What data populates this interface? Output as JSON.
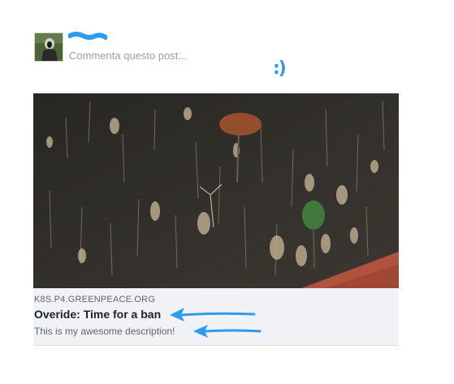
{
  "post": {
    "comment_placeholder": "Commenta questo post...",
    "emoji_annotation": ":)"
  },
  "link_card": {
    "domain": "K8S.P4.GREENPEACE.ORG",
    "title": "Overide: Time for a ban",
    "description": "This is my awesome description!"
  },
  "colors": {
    "annotation_blue": "#2d9bf0",
    "card_background": "#f0f2f5",
    "placeholder_gray": "#9aa0a6"
  },
  "icons": [
    "avatar",
    "redaction-scribble",
    "arrow-left-icon"
  ]
}
